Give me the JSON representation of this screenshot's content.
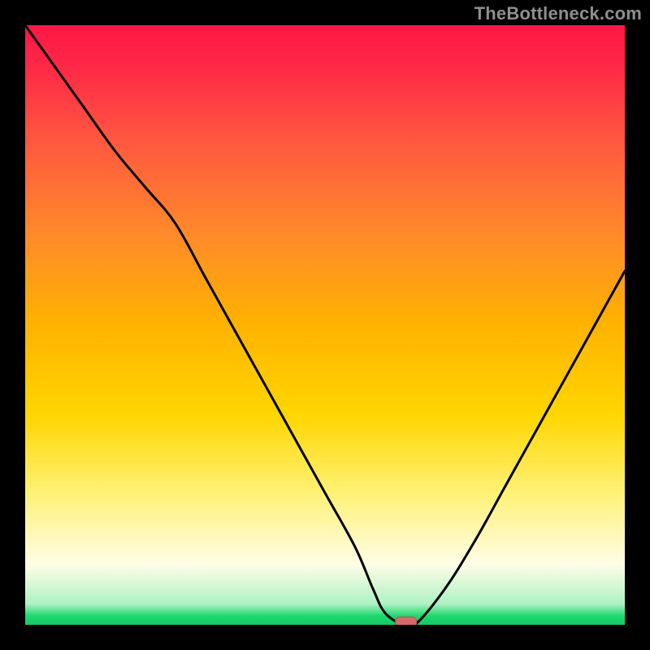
{
  "watermark": "TheBottleneck.com",
  "colors": {
    "frame": "#000000",
    "watermark": "#8e8e8e",
    "curve": "#000000",
    "marker_fill": "#d46a6a",
    "marker_stroke": "#b45252",
    "gradient_stops": [
      {
        "offset": 0.0,
        "color": "#ff1744"
      },
      {
        "offset": 0.06,
        "color": "#ff2547"
      },
      {
        "offset": 0.2,
        "color": "#ff5a3f"
      },
      {
        "offset": 0.35,
        "color": "#ff8a2a"
      },
      {
        "offset": 0.5,
        "color": "#ffb300"
      },
      {
        "offset": 0.65,
        "color": "#ffd600"
      },
      {
        "offset": 0.78,
        "color": "#fff176"
      },
      {
        "offset": 0.9,
        "color": "#fffde7"
      },
      {
        "offset": 0.965,
        "color": "#aef2c3"
      },
      {
        "offset": 0.985,
        "color": "#1ed96f"
      },
      {
        "offset": 1.0,
        "color": "#15c963"
      }
    ]
  },
  "chart_data": {
    "type": "line",
    "title": "",
    "xlabel": "",
    "ylabel": "",
    "xlim": [
      0,
      100
    ],
    "ylim": [
      0,
      100
    ],
    "series": [
      {
        "name": "bottleneck-curve",
        "x": [
          0,
          5,
          10,
          15,
          20,
          25,
          30,
          35,
          40,
          45,
          50,
          55,
          58,
          60,
          63,
          65,
          70,
          75,
          80,
          85,
          90,
          95,
          100
        ],
        "y": [
          100,
          93,
          86,
          79,
          73,
          67,
          58,
          49,
          40,
          31,
          22,
          13,
          6,
          2,
          0,
          0,
          6,
          14,
          23,
          32,
          41,
          50,
          59
        ]
      }
    ],
    "annotations": [
      {
        "name": "optimal-marker",
        "x": 63.5,
        "y": 0.5
      }
    ]
  }
}
